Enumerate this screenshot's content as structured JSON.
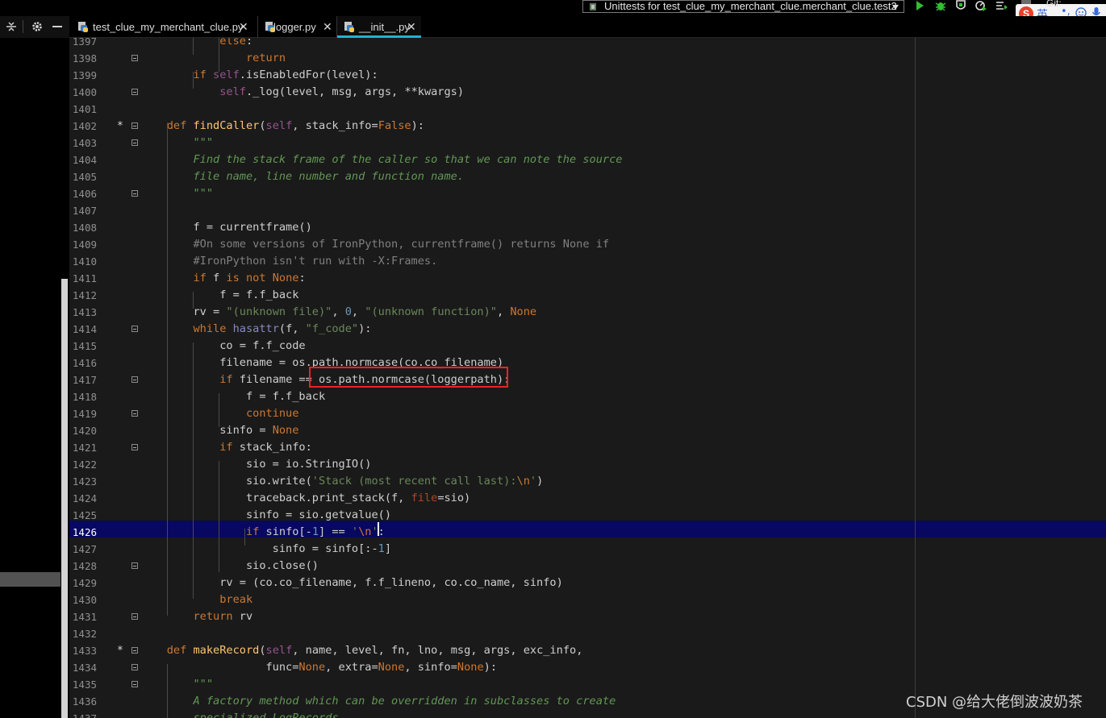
{
  "toolbar": {
    "run_config_label": "Unittests for test_clue_my_merchant_clue.merchant_clue.test2",
    "git_label": "Git:",
    "ime_label": "英"
  },
  "tabs": [
    {
      "label": "test_clue_my_merchant_clue.py",
      "active": false
    },
    {
      "label": "logger.py",
      "active": false
    },
    {
      "label": "__init__.py",
      "active": true
    }
  ],
  "colors": {
    "current_line": "#080860",
    "highlight_box": "#e22222",
    "active_tab_accent": "#1fb2d4"
  },
  "editor": {
    "current_line_number": "1426",
    "lines": [
      {
        "n": "1397",
        "html": "            <span class=\"kw\">else</span>:"
      },
      {
        "n": "1398",
        "html": "                <span class=\"kw\">return</span>"
      },
      {
        "n": "1399",
        "html": "        <span class=\"kw\">if</span> <span class=\"slf\">self</span>.isEnabledFor(level):"
      },
      {
        "n": "1400",
        "html": "            <span class=\"slf\">self</span>._log(level, msg, args, **kwargs)"
      },
      {
        "n": "1401",
        "html": ""
      },
      {
        "n": "1402",
        "html": "    <span class=\"kw\">def</span> <span class=\"fn\">findCaller</span>(<span class=\"slf\">self</span>, stack_info=<span class=\"kw\">False</span>):"
      },
      {
        "n": "1403",
        "html": "        <span class=\"doc\">\"\"\"</span>"
      },
      {
        "n": "1404",
        "html": "        <span class=\"doc\">Find the stack frame of the caller so that we can note the source</span>"
      },
      {
        "n": "1405",
        "html": "        <span class=\"doc\">file name, line number and function name.</span>"
      },
      {
        "n": "1406",
        "html": "        <span class=\"doc\">\"\"\"</span>"
      },
      {
        "n": "1407",
        "html": ""
      },
      {
        "n": "1408",
        "html": "        f = currentframe()"
      },
      {
        "n": "1409",
        "html": "        <span class=\"cmt\">#On some versions of IronPython, currentframe() returns None if</span>"
      },
      {
        "n": "1410",
        "html": "        <span class=\"cmt\">#IronPython isn't run with -X:Frames.</span>"
      },
      {
        "n": "1411",
        "html": "        <span class=\"kw\">if</span> f <span class=\"kw\">is not</span> <span class=\"kw\">None</span>:"
      },
      {
        "n": "1412",
        "html": "            f = f.f_back"
      },
      {
        "n": "1413",
        "html": "        rv = <span class=\"str\">\"(unknown file)\"</span>, <span class=\"num\">0</span>, <span class=\"str\">\"(unknown function)\"</span>, <span class=\"kw\">None</span>"
      },
      {
        "n": "1414",
        "html": "        <span class=\"kw\">while</span> <span class=\"bi\">hasattr</span>(f, <span class=\"str\">\"f_code\"</span>):"
      },
      {
        "n": "1415",
        "html": "            co = f.f_code"
      },
      {
        "n": "1416",
        "html": "            filename = os.path.normcase(co.co_filename)"
      },
      {
        "n": "1417",
        "html": "            <span class=\"kw\">if</span> filename == os.path.normcase(loggerpath):"
      },
      {
        "n": "1418",
        "html": "                f = f.f_back"
      },
      {
        "n": "1419",
        "html": "                <span class=\"kw\">continue</span>"
      },
      {
        "n": "1420",
        "html": "            sinfo = <span class=\"kw\">None</span>"
      },
      {
        "n": "1421",
        "html": "            <span class=\"kw\">if</span> stack_info:"
      },
      {
        "n": "1422",
        "html": "                sio = io.StringIO()"
      },
      {
        "n": "1423",
        "html": "                sio.write(<span class=\"str\">'Stack (most recent call last):</span><span class=\"esc\">\\n</span><span class=\"str\">'</span>)"
      },
      {
        "n": "1424",
        "html": "                traceback.print_stack(f, <span class=\"param\">file</span>=sio)"
      },
      {
        "n": "1425",
        "html": "                sinfo = sio.getvalue()"
      },
      {
        "n": "1426",
        "html": "                <span class=\"kw\">if</span> sinfo[-<span class=\"num\">1</span>] == <span class=\"str\">'</span><span class=\"esc\">\\n</span><span class=\"str\">'</span>:"
      },
      {
        "n": "1427",
        "html": "                    sinfo = sinfo[:-<span class=\"num\">1</span>]"
      },
      {
        "n": "1428",
        "html": "                sio.close()"
      },
      {
        "n": "1429",
        "html": "            rv = (co.co_filename, f.f_lineno, co.co_name, sinfo)"
      },
      {
        "n": "1430",
        "html": "            <span class=\"kw\">break</span>"
      },
      {
        "n": "1431",
        "html": "        <span class=\"kw\">return</span> rv"
      },
      {
        "n": "1432",
        "html": ""
      },
      {
        "n": "1433",
        "html": "    <span class=\"kw\">def</span> <span class=\"fn\">makeRecord</span>(<span class=\"slf\">self</span>, name, level, fn, lno, msg, args, exc_info,"
      },
      {
        "n": "1434",
        "html": "                   func=<span class=\"kw\">None</span>, extra=<span class=\"kw\">None</span>, sinfo=<span class=\"kw\">None</span>):"
      },
      {
        "n": "1435",
        "html": "        <span class=\"doc\">\"\"\"</span>"
      },
      {
        "n": "1436",
        "html": "        <span class=\"doc\">A factory method which can be overridden in subclasses to create</span>"
      },
      {
        "n": "1437",
        "html": "        <span class=\"doc\">specialized LogRecords.</span>"
      }
    ],
    "bookmarks": {
      "1402": "*",
      "1433": "*"
    }
  },
  "watermark": "CSDN @给大佬倒波波奶茶"
}
